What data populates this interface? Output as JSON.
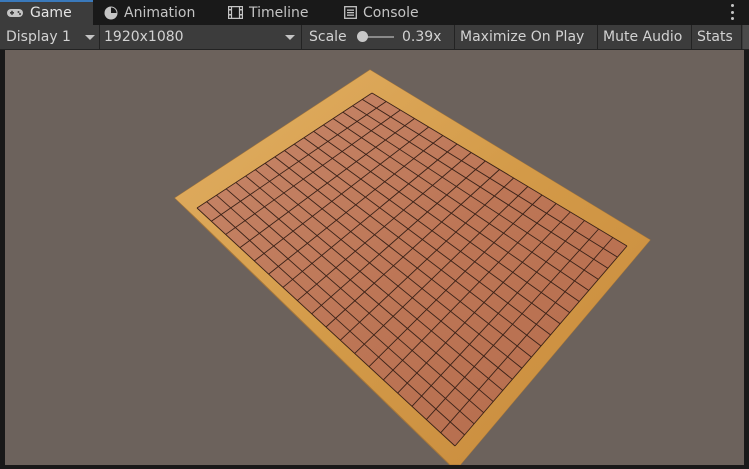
{
  "tabs": [
    {
      "label": "Game",
      "icon": "gamepad-icon",
      "active": true
    },
    {
      "label": "Animation",
      "icon": "animation-icon",
      "active": false
    },
    {
      "label": "Timeline",
      "icon": "filmstrip-icon",
      "active": false
    },
    {
      "label": "Console",
      "icon": "console-icon",
      "active": false
    }
  ],
  "toolbar": {
    "display": "Display 1",
    "resolution": "1920x1080",
    "scale_label": "Scale",
    "scale_value": "0.39x",
    "scale_fraction": 0.0,
    "maximize_on_play": "Maximize On Play",
    "mute_audio": "Mute Audio",
    "stats": "Stats"
  },
  "colors": {
    "accent": "#3a79bb",
    "viewport_background": "#6c625c",
    "board_frame": "#d8a24e",
    "board_field": "#bf7a55",
    "grid_lines": "#3b2218"
  },
  "scene": {
    "grid_columns": 18,
    "grid_rows": 18
  }
}
